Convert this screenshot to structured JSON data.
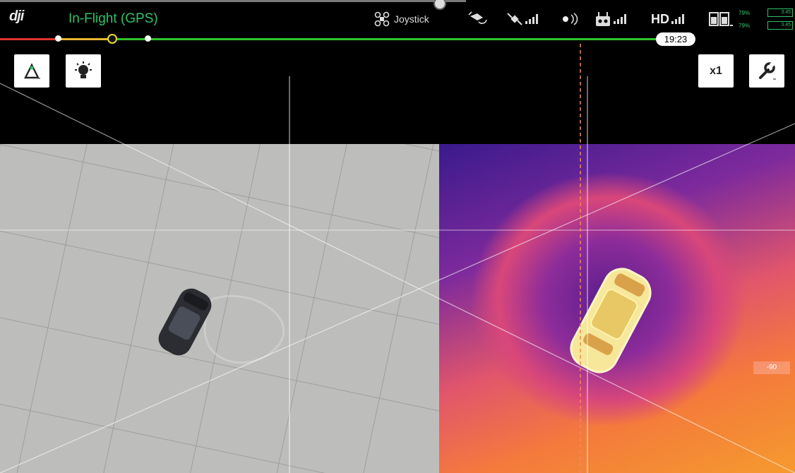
{
  "header": {
    "logo_text": "dji",
    "status": "In-Flight (GPS)",
    "flight_mode": "Joystick",
    "video_link": "HD",
    "battery": {
      "top_percent": "79%",
      "bottom_percent": "79%",
      "top_voltage": "3.45",
      "bottom_voltage": "3.45"
    }
  },
  "timeline": {
    "time": "19:23"
  },
  "tools": {
    "zoom_label": "x1"
  },
  "thermal": {
    "temp_tag": "-90"
  },
  "colors": {
    "status_green": "#2ec26a",
    "timeline_red": "#e0342b",
    "timeline_yellow": "#e9b92e",
    "timeline_green": "#2fc42d"
  }
}
